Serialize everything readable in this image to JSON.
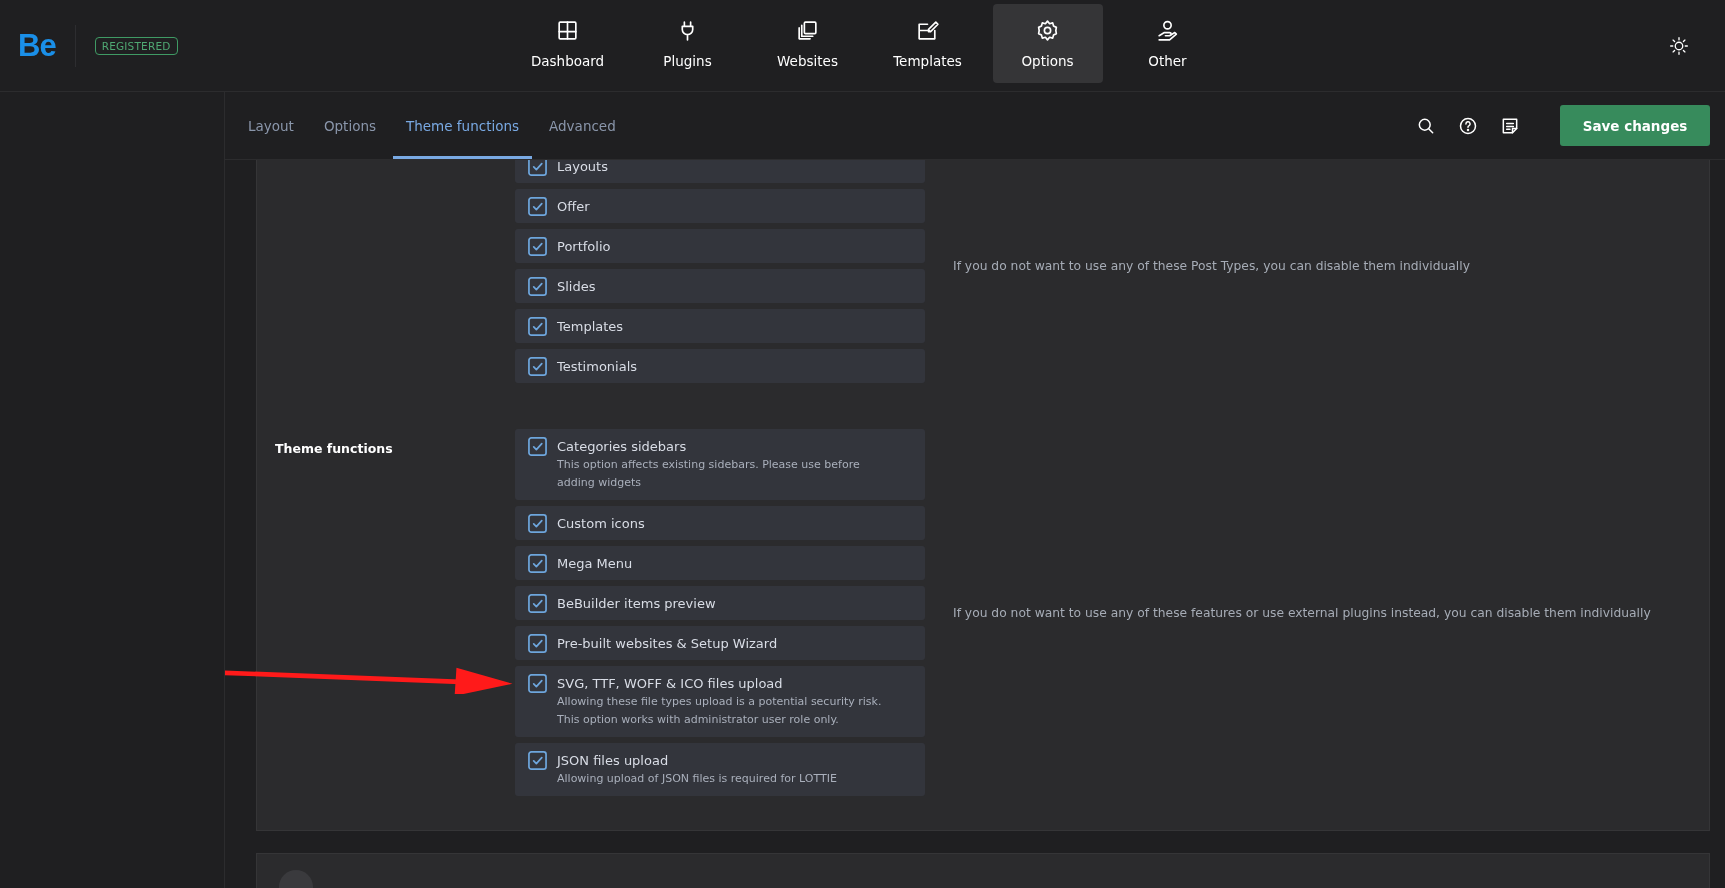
{
  "brand": {
    "logo": "Be",
    "badge": "REGISTERED"
  },
  "nav": [
    {
      "label": "Dashboard",
      "kind": "grid",
      "selected": false
    },
    {
      "label": "Plugins",
      "kind": "plug",
      "selected": false
    },
    {
      "label": "Websites",
      "kind": "stack",
      "selected": false
    },
    {
      "label": "Templates",
      "kind": "edit",
      "selected": false
    },
    {
      "label": "Options",
      "kind": "gear",
      "selected": true
    },
    {
      "label": "Other",
      "kind": "person",
      "selected": false
    }
  ],
  "tabs": [
    {
      "label": "Layout",
      "selected": false
    },
    {
      "label": "Options",
      "selected": false
    },
    {
      "label": "Theme functions",
      "selected": true
    },
    {
      "label": "Advanced",
      "selected": false
    }
  ],
  "toolbar": {
    "save": "Save changes"
  },
  "sections": [
    {
      "description": "If you do not want to use any of these Post Types, you can disable them individually",
      "options": [
        {
          "label": "Layouts",
          "checked": true
        },
        {
          "label": "Offer",
          "checked": true
        },
        {
          "label": "Portfolio",
          "checked": true
        },
        {
          "label": "Slides",
          "checked": true
        },
        {
          "label": "Templates",
          "checked": true
        },
        {
          "label": "Testimonials",
          "checked": true
        }
      ]
    },
    {
      "label": "Theme functions",
      "description": "If you do not want to use any of these features or use external plugins instead, you can disable them individually",
      "options": [
        {
          "label": "Categories sidebars",
          "checked": true,
          "note": "This option affects existing sidebars. Please use before adding widgets"
        },
        {
          "label": "Custom icons",
          "checked": true
        },
        {
          "label": "Mega Menu",
          "checked": true
        },
        {
          "label": "BeBuilder items preview",
          "checked": true
        },
        {
          "label": "Pre-built websites & Setup Wizard",
          "checked": true
        },
        {
          "label": "SVG, TTF, WOFF & ICO files upload",
          "checked": true,
          "note": "Allowing these file types upload is a potential security risk. This option works with administrator user role only.",
          "pointed": true
        },
        {
          "label": "JSON files upload",
          "checked": true,
          "note": "Allowing upload of JSON files is required for LOTTIE"
        }
      ]
    }
  ]
}
